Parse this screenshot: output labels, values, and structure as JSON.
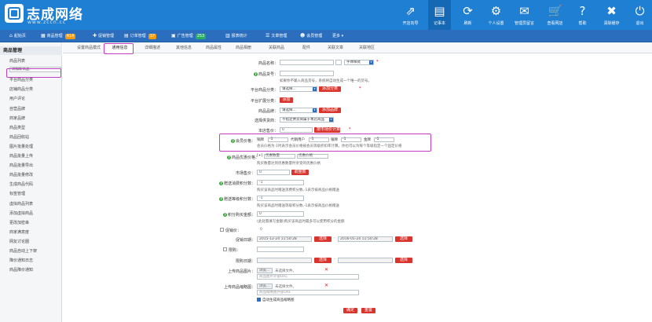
{
  "brand": {
    "name": "志成网络",
    "url": "www.zccn.cc"
  },
  "toolbar": [
    {
      "label": "开店向导",
      "icon": "share-icon"
    },
    {
      "label": "记事本",
      "icon": "note-icon"
    },
    {
      "label": "刷新",
      "icon": "refresh-icon"
    },
    {
      "label": "个人设置",
      "icon": "gear-icon"
    },
    {
      "label": "管理员留言",
      "icon": "chat-icon"
    },
    {
      "label": "查看网店",
      "icon": "cart-icon"
    },
    {
      "label": "帮助",
      "icon": "help-icon"
    },
    {
      "label": "清除缓存",
      "icon": "clear-icon"
    },
    {
      "label": "退出",
      "icon": "power-icon"
    }
  ],
  "nav": [
    {
      "label": "起始页",
      "badge": ""
    },
    {
      "label": "商品管理",
      "badge": "414",
      "badge_color": "#f39c12"
    },
    {
      "label": "促销管理",
      "badge": ""
    },
    {
      "label": "订单管理",
      "badge": "37",
      "badge_color": "#f39c12"
    },
    {
      "label": "广告管理",
      "badge": "253",
      "badge_color": "#27ae60"
    },
    {
      "label": "报表统计",
      "badge": ""
    },
    {
      "label": "文章管理",
      "badge": ""
    },
    {
      "label": "会员管理",
      "badge": ""
    },
    {
      "label": "更多",
      "badge": ""
    }
  ],
  "sidebar": {
    "header": "商品管理",
    "items": [
      "商品列表",
      "添加新商品",
      "平台商品分类",
      "店铺商品分类",
      "用户评论",
      "自营品牌",
      "商家品牌",
      "商品类型",
      "商品回收站",
      "图片批量处理",
      "商品批量上传",
      "商品批量导出",
      "商品批量修改",
      "生成商品代码",
      "标签管理",
      "虚拟商品列表",
      "添加虚拟商品",
      "更改加密串",
      "商家满意度",
      "网友讨论圈",
      "商品自动上下架",
      "降价通知日志",
      "商品降价通知"
    ],
    "selected_index": 1
  },
  "tabs": [
    "设置商品模式",
    "通用信息",
    "详细描述",
    "其他信息",
    "商品属性",
    "商品相册",
    "关联商品",
    "配件",
    "关联文章",
    "关联地区"
  ],
  "active_tab_index": 1,
  "form": {
    "goods_name_label": "商品名称：",
    "font_style": "字体样式",
    "goods_sn_label": "商品货号：",
    "goods_sn_hint": "如果你不输入商品货号，系统将自动生成一个唯一的货号。",
    "platform_cat_label": "平台商品分类：",
    "please_select": "请选择...",
    "add_category_btn": "添加分类",
    "platform_ext_label": "平台扩展分类：",
    "add_btn": "添加",
    "brand_label": "商品品牌：",
    "add_brand_btn": "添加品牌",
    "supplier_label": "选择供货商：",
    "supplier_value": "不指定供货商属于本店商品",
    "shop_price_label": "本店售价：",
    "shop_price_value": "0",
    "market_price_btn": "按市场价计算",
    "member_price_label": "会员价格：",
    "member_prices": [
      {
        "name": "铜牌",
        "value": "-1"
      },
      {
        "name": "代销用户",
        "value": "-1"
      },
      {
        "name": "银牌",
        "value": "-1"
      },
      {
        "name": "金牌",
        "value": "-1"
      }
    ],
    "member_price_hint": "会员价格为-1时表示会员价格按会员等级折扣率计算。你也可以为每个等级指定一个固定价格",
    "volume_price_label": "商品优惠价格：",
    "volume_add": "[+]",
    "volume_qty": "优惠数量",
    "volume_price": "优惠价格",
    "volume_hint": "购买数量达到优惠数量时享受的优惠价格",
    "market_price_label": "市场售价：",
    "market_price_value": "0",
    "round_btn": "取整数",
    "give_integral_label": "赠送消费积分数：",
    "give_integral_value": "-1",
    "give_integral_hint": "购买该商品时赠送消费积分数,-1表示按商品价格赠送",
    "rank_integral_label": "赠送等级积分数：",
    "rank_integral_value": "-1",
    "rank_integral_hint": "购买该商品时赠送等级积分数,-1表示按商品价格赠送",
    "integral_label": "积分购买金额：",
    "integral_value": "0",
    "integral_hint": "(此处需填写金额)购买该商品时最多可以使用积分的金额",
    "promote_label": "促销价：",
    "promote_value": "0",
    "promote_date_label": "促销日期：",
    "promote_start": "2015-12-24 11:50:28",
    "promote_end": "2016-01-24 11:50:28",
    "choose_btn": "选择",
    "limit_buy_label": "限购：",
    "limit_date_label": "限购日期：",
    "upload_img_label": "上传商品图片：",
    "upload_thumb_label": "上传商品缩略图：",
    "browse_btn": "浏览...",
    "no_file": "未选择文件。",
    "img_url_placeholder": "商品图片外部URL",
    "thumb_url_placeholder": "商品缩略图外部URL",
    "auto_thumb_label": "自动生成商品缩略图",
    "submit_btn": "确定",
    "reset_btn": "重置"
  },
  "colors": {
    "header": "#1f7fd2",
    "nav": "#2a6ebd",
    "highlight": "#c43ec4",
    "danger": "#d9352e"
  }
}
